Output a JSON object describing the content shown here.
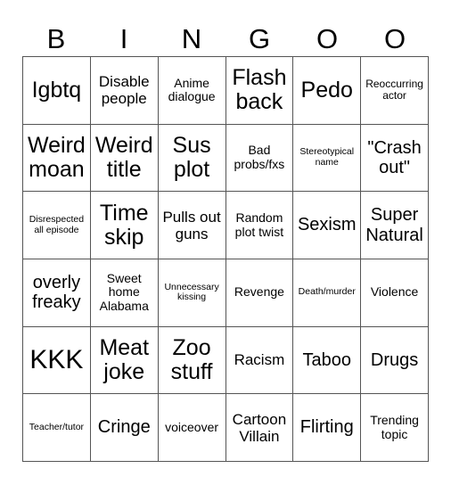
{
  "header": [
    "B",
    "I",
    "N",
    "G",
    "O",
    "O"
  ],
  "cells": [
    [
      "Igbtq",
      "Disable people",
      "Anime dialogue",
      "Flash back",
      "Pedo",
      "Reoccurring actor"
    ],
    [
      "Weird moan",
      "Weird title",
      "Sus plot",
      "Bad probs/fxs",
      "Stereotypical name",
      "\"Crash out\""
    ],
    [
      "Disrespected all episode",
      "Time skip",
      "Pulls out guns",
      "Random plot twist",
      "Sexism",
      "Super Natural"
    ],
    [
      "overly freaky",
      "Sweet home Alabama",
      "Unnecessary kissing",
      "Revenge",
      "Death/murder",
      "Violence"
    ],
    [
      "KKK",
      "Meat joke",
      "Zoo stuff",
      "Racism",
      "Taboo",
      "Drugs"
    ],
    [
      "Teacher/tutor",
      "Cringe",
      "voiceover",
      "Cartoon Villain",
      "Flirting",
      "Trending topic"
    ]
  ]
}
